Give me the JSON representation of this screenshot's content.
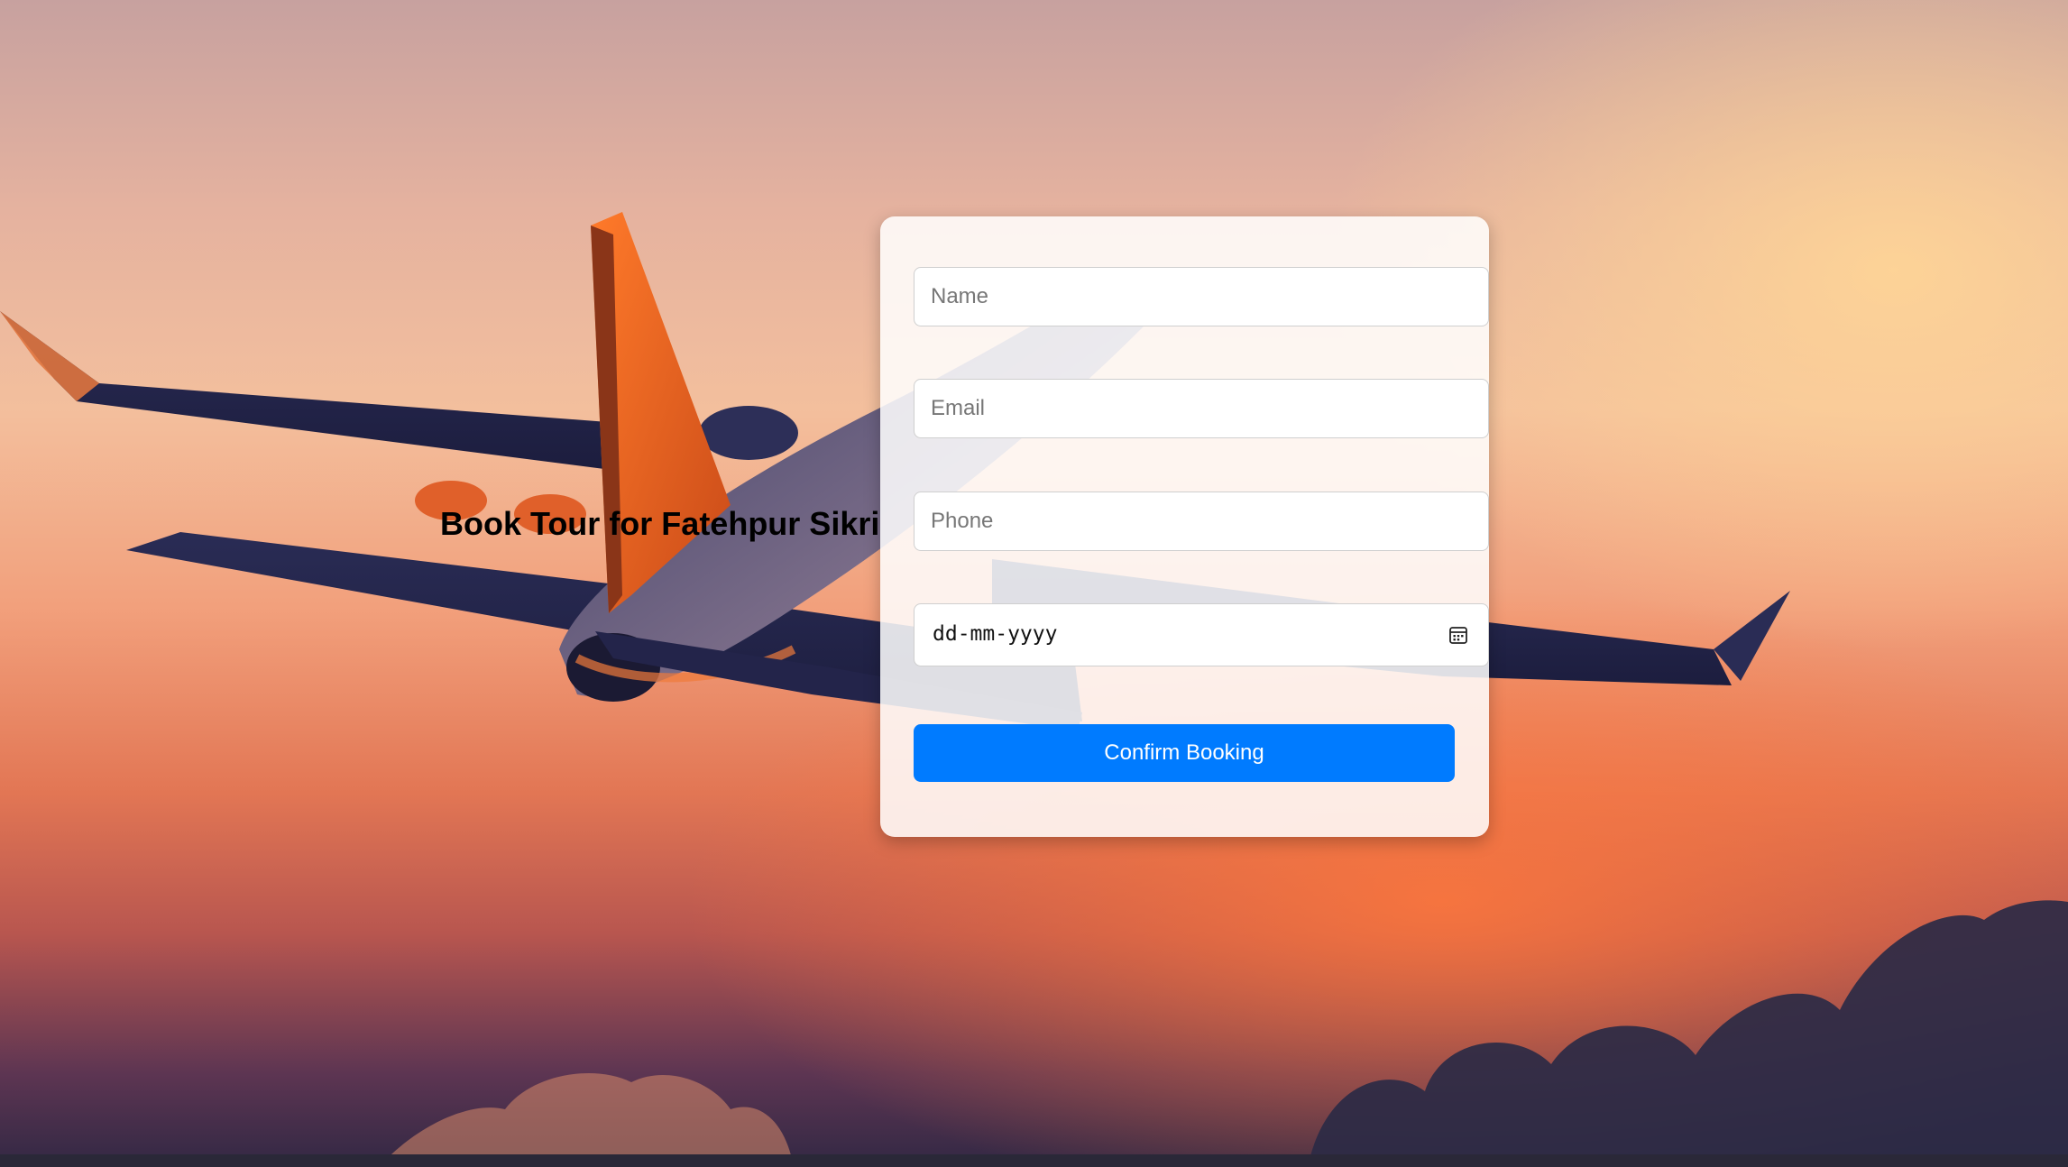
{
  "page": {
    "title": "Book Tour for Fatehpur Sikri"
  },
  "form": {
    "name_placeholder": "Name",
    "email_placeholder": "Email",
    "phone_placeholder": "Phone",
    "date_placeholder": "dd-mm-yyyy",
    "date_icon": "calendar-icon",
    "submit_label": "Confirm Booking"
  },
  "colors": {
    "accent": "#007bff",
    "card": "#ffffff",
    "sunset_top": "#c7a19f",
    "sunset_mid": "#f2a07c",
    "sunset_bottom": "#322844"
  },
  "background": {
    "image": "airplane-flying-at-sunset"
  }
}
